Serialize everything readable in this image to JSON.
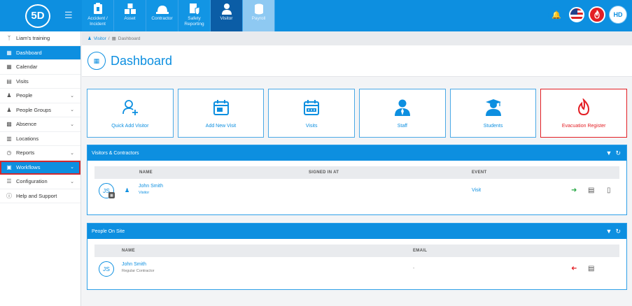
{
  "app": {
    "logo_text": "5D",
    "modules": [
      {
        "label": "Accident / Incident",
        "icon": "accident-icon"
      },
      {
        "label": "Asset",
        "icon": "asset-icon"
      },
      {
        "label": "Contractor",
        "icon": "hardhat-icon"
      },
      {
        "label": "Safety Reporting",
        "icon": "shield-icon"
      },
      {
        "label": "Visitor",
        "icon": "person-icon",
        "active": true
      },
      {
        "label": "Payroll",
        "icon": "coins-icon"
      }
    ],
    "user_initials": "HD"
  },
  "sidebar": {
    "items": [
      {
        "label": "Liam's training",
        "icon": "branch-icon"
      },
      {
        "label": "Dashboard",
        "icon": "dashboard-icon",
        "active": true
      },
      {
        "label": "Calendar",
        "icon": "calendar-icon"
      },
      {
        "label": "Visits",
        "icon": "visits-icon"
      },
      {
        "label": "People",
        "icon": "people-icon",
        "expandable": true
      },
      {
        "label": "People Groups",
        "icon": "people-groups-icon",
        "expandable": true
      },
      {
        "label": "Absence",
        "icon": "absence-icon",
        "expandable": true
      },
      {
        "label": "Locations",
        "icon": "locations-icon"
      },
      {
        "label": "Reports",
        "icon": "reports-icon",
        "expandable": true
      },
      {
        "label": "Workflows",
        "icon": "workflows-icon",
        "expandable": true,
        "highlighted": true
      },
      {
        "label": "Configuration",
        "icon": "configuration-icon",
        "expandable": true
      },
      {
        "label": "Help and Support",
        "icon": "help-icon"
      }
    ]
  },
  "breadcrumb": {
    "root": "Visitor",
    "separator": "/",
    "current": "Dashboard"
  },
  "page": {
    "title": "Dashboard"
  },
  "cards": [
    {
      "label": "Quick Add Visitor",
      "icon": "add-user-icon"
    },
    {
      "label": "Add New Visit",
      "icon": "calendar-add-icon"
    },
    {
      "label": "Visits",
      "icon": "calendar-dots-icon"
    },
    {
      "label": "Staff",
      "icon": "staff-icon"
    },
    {
      "label": "Students",
      "icon": "student-icon"
    },
    {
      "label": "Evacuation Register",
      "icon": "fire-icon"
    }
  ],
  "visitors_panel": {
    "title": "Visitors & Contractors",
    "columns": [
      "NAME",
      "SIGNED IN AT",
      "EVENT"
    ],
    "rows": [
      {
        "initials": "JS",
        "name": "John Smith",
        "type": "Visitor",
        "signed_in_at": "",
        "event": "Visit"
      }
    ]
  },
  "onsite_panel": {
    "title": "People On Site",
    "columns": [
      "NAME",
      "EMAIL"
    ],
    "rows": [
      {
        "initials": "JS",
        "name": "John Smith",
        "type": "Regular Contractor",
        "email": "-"
      }
    ]
  },
  "colors": {
    "primary": "#0d8fe0",
    "danger": "#e31e24",
    "success": "#27a844"
  }
}
